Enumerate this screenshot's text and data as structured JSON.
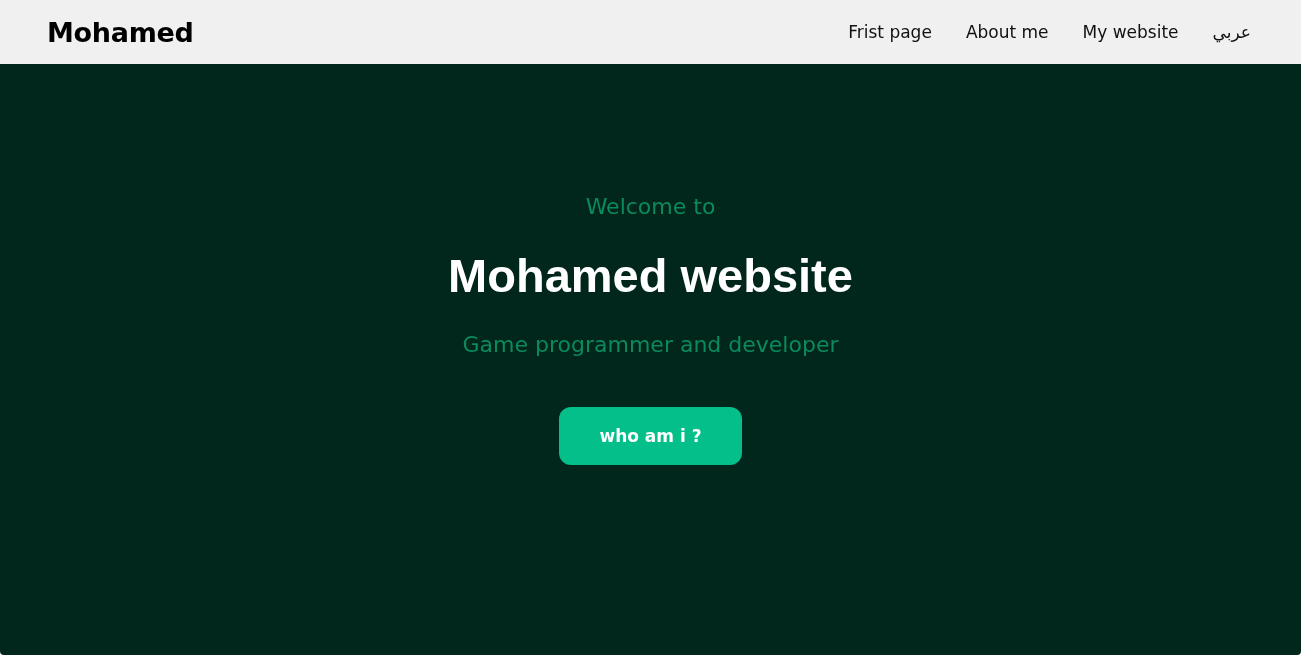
{
  "header": {
    "logo": "Mohamed",
    "nav": [
      "Frist page",
      "About me",
      "My website",
      "عربي"
    ]
  },
  "hero": {
    "eyebrow": "Welcome to",
    "title": "Mohamed website",
    "subtitle": "Game programmer and developer",
    "button": "who am i ?"
  }
}
